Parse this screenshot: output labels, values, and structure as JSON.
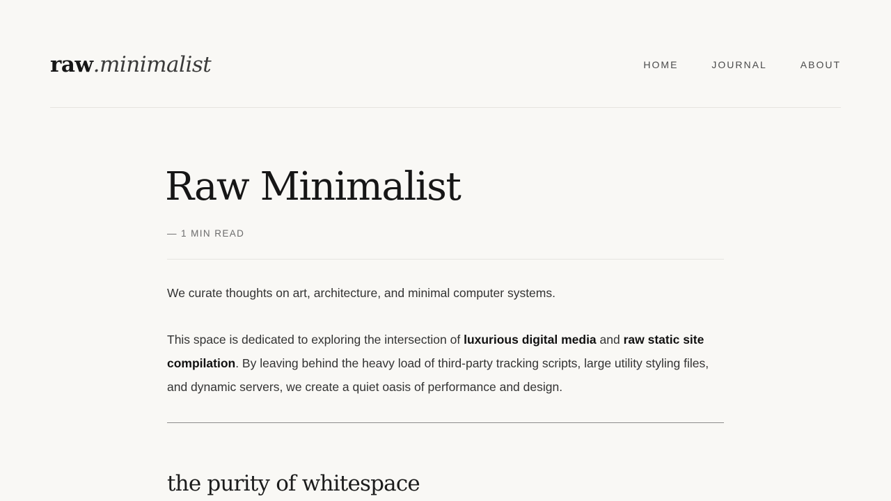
{
  "header": {
    "logo": {
      "strong": "raw",
      "dot": ".",
      "em": "minimalist"
    },
    "nav": [
      {
        "label": "HOME"
      },
      {
        "label": "JOURNAL"
      },
      {
        "label": "ABOUT"
      }
    ]
  },
  "article": {
    "title": "Raw Minimalist",
    "meta": "— 1 MIN READ",
    "intro": "We curate thoughts on art, architecture, and minimal computer systems.",
    "body": {
      "part1": "This space is dedicated to exploring the intersection of ",
      "strong1": "luxurious digital media",
      "part2": " and ",
      "strong2": "raw static site compilation",
      "part3": ". By leaving behind the heavy load of third-party tracking scripts, large utility styling files, and dynamic servers, we create a quiet oasis of performance and design."
    },
    "section_heading": "the purity of whitespace"
  },
  "colors": {
    "background": "#f9f8f5",
    "text": "#1c1c1c",
    "muted": "#6b6b6b",
    "divider": "#e6e4df"
  }
}
